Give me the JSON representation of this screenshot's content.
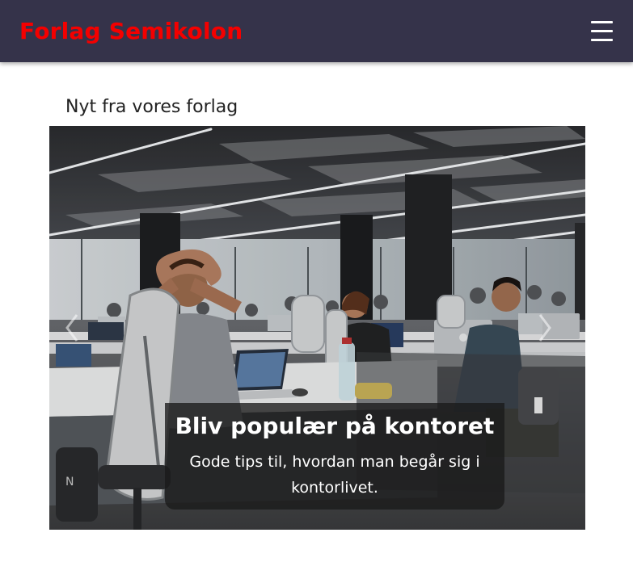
{
  "navbar": {
    "brand": "Forlag Semikolon",
    "menu_icon": "hamburger-menu-icon",
    "colors": {
      "background": "#35334a",
      "brand": "#f40000"
    }
  },
  "news": {
    "heading": "Nyt fra vores forlag",
    "slides": [
      {
        "image": "open-office-photo",
        "title": "Bliv populær på kontoret",
        "text": "Gode tips til, hvordan man begår sig i kontorlivet."
      }
    ],
    "controls": {
      "prev_icon": "chevron-left-icon",
      "next_icon": "chevron-right-icon"
    }
  }
}
